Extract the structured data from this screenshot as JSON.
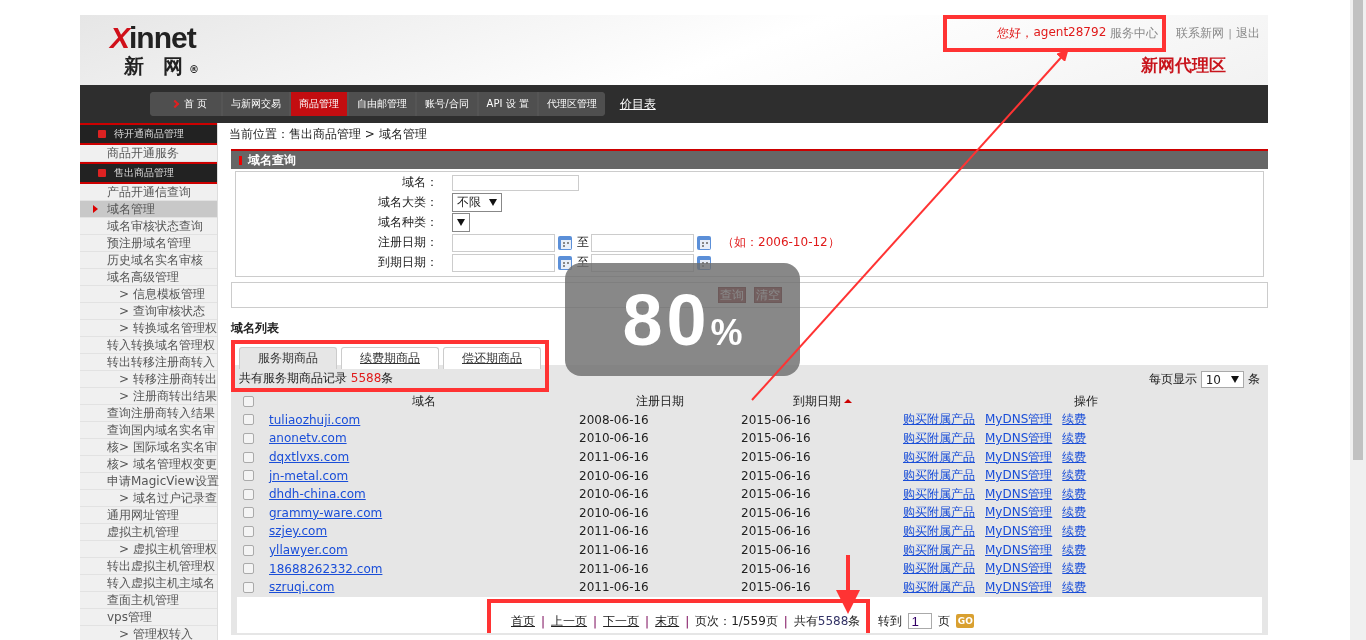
{
  "header": {
    "logo": {
      "mark": "X",
      "name": "innet",
      "cn": "新 网",
      "reg": "®"
    },
    "greeting": "您好，",
    "user": "agent28792",
    "links": [
      {
        "kind": "link",
        "text": "服务中心"
      },
      {
        "kind": "link",
        "text": "联系新网"
      },
      {
        "kind": "sep",
        "text": "|"
      },
      {
        "kind": "link",
        "text": "退出"
      }
    ],
    "zone_title": "新网代理区"
  },
  "nav": {
    "items": [
      {
        "label": "首 页",
        "arrow": true,
        "selected": false
      },
      {
        "label": "与新网交易",
        "arrow": false,
        "selected": false
      },
      {
        "label": "商品管理",
        "arrow": false,
        "selected": true
      },
      {
        "label": "自由邮管理",
        "arrow": false,
        "selected": false
      },
      {
        "label": "账号/合同",
        "arrow": false,
        "selected": false
      },
      {
        "label": "API 设 置",
        "arrow": false,
        "selected": false
      },
      {
        "label": "代理区管理",
        "arrow": false,
        "selected": false
      }
    ],
    "price_link": "价目表"
  },
  "sidebar": {
    "sections": [
      {
        "title": "待开通商品管理",
        "items": [
          {
            "label": "商品开通服务",
            "selected": false
          }
        ]
      },
      {
        "title": "售出商品管理",
        "items": [
          {
            "label": "产品开通信查询",
            "selected": false
          },
          {
            "label": "域名管理",
            "selected": true
          },
          {
            "label": "域名审核状态查询",
            "selected": false
          },
          {
            "label": "预注册域名管理",
            "selected": false
          },
          {
            "label": "历史域名实名审核",
            "selected": false
          },
          {
            "label": "域名高级管理",
            "selected": false,
            "children": [
              {
                "label": "> 信息模板管理",
                "selected": false
              },
              {
                "label": "> 查询审核状态",
                "selected": false
              },
              {
                "label": "> 转换域名管理权",
                "selected": false
              }
            ]
          },
          {
            "label": "转入转换域名管理权",
            "selected": false
          },
          {
            "label": "转出转移注册商转入",
            "selected": false,
            "children": [
              {
                "label": "> 转移注册商转出",
                "selected": false
              },
              {
                "label": "> 注册商转出结果",
                "selected": false
              }
            ]
          },
          {
            "label": "查询注册商转入结果",
            "selected": false
          },
          {
            "label": "查询国内域名实名审",
            "selected": false
          },
          {
            "label": "核> 国际域名实名审",
            "selected": false
          },
          {
            "label": "核> 域名管理权变更",
            "selected": false
          },
          {
            "label": "申请MagicView设置",
            "selected": false,
            "children": [
              {
                "label": "> 域名过户记录查",
                "selected": false
              }
            ]
          },
          {
            "label": "通用网址管理",
            "selected": false
          },
          {
            "label": "虚拟主机管理",
            "selected": false,
            "children": [
              {
                "label": "> 虚拟主机管理权",
                "selected": false
              }
            ]
          },
          {
            "label": "转出虚拟主机管理权",
            "selected": false
          },
          {
            "label": "转入虚拟主机主域名",
            "selected": false
          },
          {
            "label": "查面主机管理",
            "selected": false
          },
          {
            "label": "vps管理",
            "selected": false,
            "children": [
              {
                "label": "> 管理权转入",
                "selected": false
              }
            ]
          }
        ]
      }
    ]
  },
  "breadcrumb": "当前位置：售出商品管理 > 域名管理",
  "query": {
    "title": "域名查询",
    "fields": [
      {
        "kind": "text",
        "label": "域名："
      },
      {
        "kind": "select",
        "label": "域名大类：",
        "value": "不限"
      },
      {
        "kind": "select",
        "label": "域名种类："
      },
      {
        "kind": "daterange",
        "label": "注册日期：",
        "to": "至",
        "hint": "（如：2006-10-12）"
      },
      {
        "kind": "daterange",
        "label": "到期日期：",
        "to": "至"
      }
    ],
    "buttons": [
      "查询",
      "清空"
    ]
  },
  "list": {
    "title": "域名列表",
    "tabs": [
      {
        "label": "服务期商品",
        "selected": true
      },
      {
        "label": "续费期商品",
        "selected": false
      },
      {
        "label": "偿还期商品",
        "selected": false
      }
    ],
    "count": {
      "before": "共有服务期商品记录 ",
      "value": "5588",
      "after": "条"
    },
    "per_page": {
      "label": "每页显示",
      "value": "10",
      "unit": "条"
    },
    "select_all_checked": false,
    "columns": [
      "域名",
      "注册日期",
      "到期日期",
      "操作"
    ],
    "rows": [
      {
        "domain": "tuliaozhuji.com",
        "registered": "2008-06-16",
        "expires": "2015-06-16",
        "checked": false,
        "actions": [
          "购买附属产品",
          "MyDNS管理",
          "续费"
        ]
      },
      {
        "domain": "anonetv.com",
        "registered": "2010-06-16",
        "expires": "2015-06-16",
        "checked": false,
        "actions": [
          "购买附属产品",
          "MyDNS管理",
          "续费"
        ]
      },
      {
        "domain": "dqxtlvxs.com",
        "registered": "2011-06-16",
        "expires": "2015-06-16",
        "checked": false,
        "actions": [
          "购买附属产品",
          "MyDNS管理",
          "续费"
        ]
      },
      {
        "domain": "jn-metal.com",
        "registered": "2010-06-16",
        "expires": "2015-06-16",
        "checked": false,
        "actions": [
          "购买附属产品",
          "MyDNS管理",
          "续费"
        ]
      },
      {
        "domain": "dhdh-china.com",
        "registered": "2010-06-16",
        "expires": "2015-06-16",
        "checked": false,
        "actions": [
          "购买附属产品",
          "MyDNS管理",
          "续费"
        ]
      },
      {
        "domain": "grammy-ware.com",
        "registered": "2010-06-16",
        "expires": "2015-06-16",
        "checked": false,
        "actions": [
          "购买附属产品",
          "MyDNS管理",
          "续费"
        ]
      },
      {
        "domain": "szjey.com",
        "registered": "2011-06-16",
        "expires": "2015-06-16",
        "checked": false,
        "actions": [
          "购买附属产品",
          "MyDNS管理",
          "续费"
        ]
      },
      {
        "domain": "yllawyer.com",
        "registered": "2011-06-16",
        "expires": "2015-06-16",
        "checked": false,
        "actions": [
          "购买附属产品",
          "MyDNS管理",
          "续费"
        ]
      },
      {
        "domain": "18688262332.com",
        "registered": "2011-06-16",
        "expires": "2015-06-16",
        "checked": false,
        "actions": [
          "购买附属产品",
          "MyDNS管理",
          "续费"
        ]
      },
      {
        "domain": "szruqi.com",
        "registered": "2011-06-16",
        "expires": "2015-06-16",
        "checked": false,
        "actions": [
          "购买附属产品",
          "MyDNS管理",
          "续费"
        ]
      }
    ],
    "pager": {
      "items": [
        {
          "kind": "link",
          "text": "首页"
        },
        {
          "kind": "sep",
          "text": "|"
        },
        {
          "kind": "link",
          "text": "上一页"
        },
        {
          "kind": "sep",
          "text": "|"
        },
        {
          "kind": "link",
          "text": "下一页"
        },
        {
          "kind": "sep",
          "text": "|"
        },
        {
          "kind": "link",
          "text": "末页"
        },
        {
          "kind": "sep",
          "text": "|"
        },
        {
          "kind": "text",
          "text": "页次：1/559页"
        },
        {
          "kind": "sep",
          "text": "|"
        }
      ],
      "total_before": "共有",
      "total_value": "5588",
      "total_after": "条",
      "goto": "转到",
      "page_input": "1",
      "page_unit": "页",
      "go": "GO"
    }
  },
  "zoom": {
    "value": "80",
    "unit": "%"
  },
  "annotations": [
    {
      "kind": "box"
    },
    {
      "kind": "box"
    },
    {
      "kind": "box"
    },
    {
      "kind": "arrow"
    },
    {
      "kind": "arrow"
    }
  ]
}
